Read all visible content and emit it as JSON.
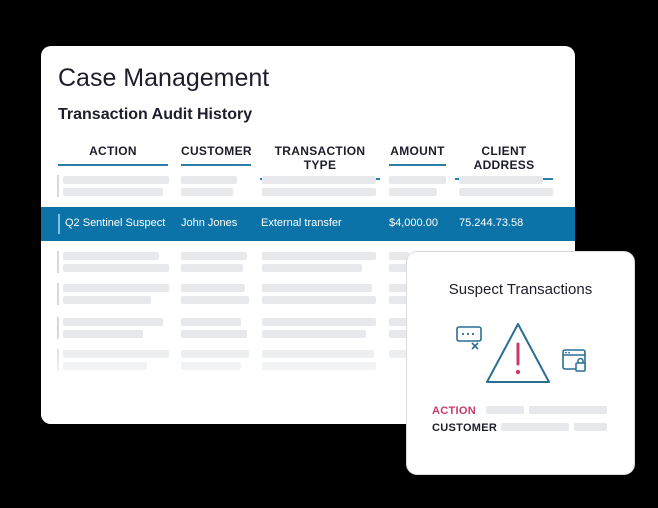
{
  "page": {
    "title": "Case Management",
    "subtitle": "Transaction Audit History"
  },
  "table": {
    "columns": [
      "ACTION",
      "CUSTOMER",
      "TRANSACTION TYPE",
      "AMOUNT",
      "CLIENT ADDRESS"
    ],
    "selected_row": {
      "action": "Q2 Sentinel Suspect",
      "customer": "John Jones",
      "transaction_type": "External transfer",
      "amount": "$4,000.00",
      "client_address": "75.244.73.58"
    }
  },
  "popup": {
    "title": "Suspect Transactions",
    "action_label": "ACTION",
    "customer_label": "CUSTOMER",
    "icons": [
      "chat-error-icon",
      "warning-triangle-icon",
      "browser-lock-icon"
    ]
  },
  "colors": {
    "accent": "#0b73a8",
    "action_label": "#c83a6e",
    "icon_stroke": "#2a6f91"
  }
}
